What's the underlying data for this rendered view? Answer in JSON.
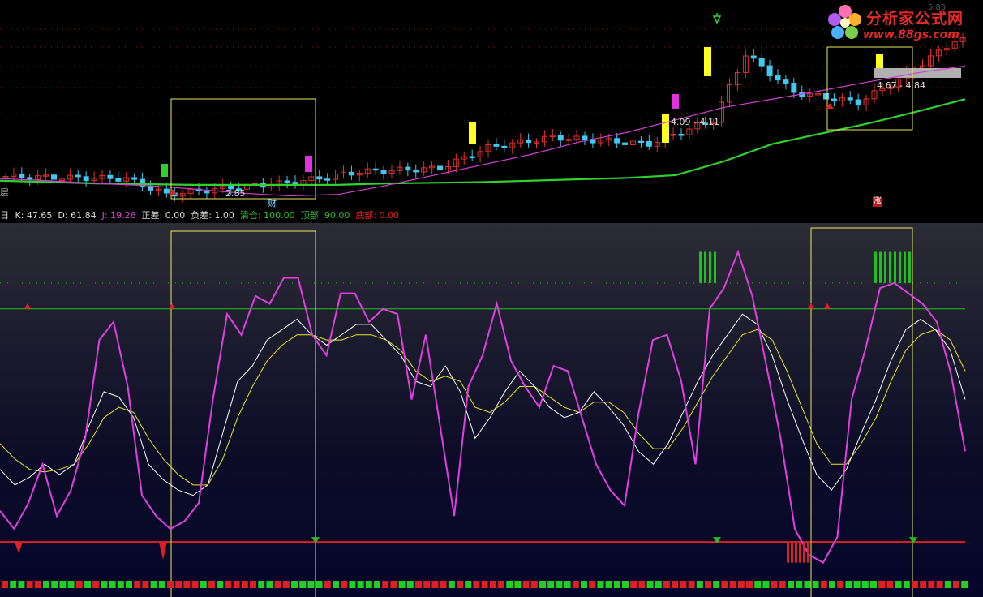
{
  "logo": {
    "name": "分析家公式网",
    "url": "www.88gs.com",
    "faint_value": "5.85"
  },
  "upper_panel": {
    "left_edge_label": "层",
    "annotations": {
      "low_price": "2.85",
      "signal_cai": "财",
      "range_1": "4.09 - 4.11",
      "range_2": "4.67 - 4.84",
      "signal_zhang": "涨"
    }
  },
  "indicator_legend": {
    "prefix": "日",
    "items": [
      {
        "label": "K:",
        "value": "47.65",
        "color": "#d8d8d8"
      },
      {
        "label": "D:",
        "value": "61.84",
        "color": "#d8d8d8"
      },
      {
        "label": "J:",
        "value": "19.26",
        "color": "#e040e0"
      },
      {
        "label": "正差:",
        "value": "0.00",
        "color": "#d8d8d8"
      },
      {
        "label": "负差:",
        "value": "1.00",
        "color": "#d8d8d8"
      },
      {
        "label": "清仓:",
        "value": "100.00",
        "color": "#30c030"
      },
      {
        "label": "顶部:",
        "value": "90.00",
        "color": "#30c030"
      },
      {
        "label": "底部:",
        "value": "0.00",
        "color": "#e02020"
      }
    ]
  },
  "colors": {
    "up_candle": "#e03030",
    "down_candle": "#40c8f0",
    "signal_yellow": "#ffff20",
    "signal_magenta": "#e030e0",
    "ma_green": "#30d030",
    "ma_magenta": "#d040d0",
    "kdj_k": "#ffffff",
    "kdj_d": "#e8e820",
    "kdj_j": "#e040e0",
    "top_line": "#20c020",
    "bottom_line": "#e02020",
    "box": "#e8e860"
  },
  "chart_data": [
    {
      "type": "line",
      "panel": "price (candlestick)",
      "description_series": [
        {
          "name": "",
          "role": "short MA (magenta)",
          "values": [
            2.95,
            2.92,
            2.88,
            2.85,
            2.8,
            2.74,
            2.7,
            2.72,
            2.85,
            3.0,
            3.15,
            3.3,
            3.48,
            3.62,
            3.8,
            3.98,
            4.1,
            4.22,
            4.35,
            4.48,
            4.58
          ]
        },
        {
          "name": "",
          "role": "long MA (green)",
          "values": [
            2.92,
            2.9,
            2.88,
            2.87,
            2.86,
            2.86,
            2.86,
            2.86,
            2.88,
            2.89,
            2.9,
            2.92,
            2.94,
            2.96,
            3.0,
            3.2,
            3.45,
            3.6,
            3.75,
            3.92,
            4.1
          ]
        }
      ],
      "annotations": [
        "2.85",
        "4.09 - 4.11",
        "4.67 - 4.84"
      ]
    },
    {
      "type": "line",
      "panel": "KDJ indicator",
      "ylim": [
        -10,
        120
      ],
      "reference_lines": {
        "top": 90,
        "clear": 100,
        "bottom": 0
      },
      "series": [
        {
          "name": "J",
          "values": [
            12,
            5,
            15,
            30,
            10,
            20,
            40,
            78,
            85,
            60,
            18,
            10,
            5,
            8,
            15,
            55,
            88,
            80,
            95,
            92,
            102,
            102,
            80,
            72,
            96,
            96,
            85,
            90,
            88,
            55,
            80,
            45,
            10,
            60,
            72,
            92,
            70,
            60,
            52,
            68,
            66,
            48,
            30,
            20,
            14,
            50,
            78,
            80,
            62,
            30,
            90,
            98,
            112,
            95,
            68,
            40,
            5,
            -5,
            -8,
            2,
            55,
            75,
            98,
            100,
            96,
            92,
            85,
            65,
            35
          ]
        },
        {
          "name": "K",
          "values": [
            28,
            22,
            25,
            30,
            26,
            30,
            45,
            58,
            56,
            48,
            30,
            24,
            20,
            18,
            22,
            42,
            62,
            68,
            78,
            82,
            86,
            80,
            76,
            80,
            84,
            84,
            78,
            72,
            62,
            60,
            68,
            58,
            40,
            48,
            58,
            66,
            60,
            52,
            48,
            50,
            58,
            52,
            45,
            35,
            30,
            38,
            50,
            62,
            72,
            80,
            88,
            84,
            72,
            55,
            40,
            26,
            20,
            28,
            42,
            55,
            70,
            82,
            86,
            82,
            74,
            55
          ]
        },
        {
          "name": "D",
          "values": [
            38,
            32,
            28,
            27,
            28,
            30,
            38,
            48,
            52,
            50,
            40,
            32,
            26,
            22,
            22,
            32,
            48,
            60,
            70,
            76,
            80,
            80,
            78,
            78,
            80,
            80,
            78,
            74,
            66,
            62,
            64,
            62,
            52,
            50,
            54,
            60,
            60,
            56,
            52,
            50,
            54,
            54,
            50,
            42,
            36,
            36,
            44,
            54,
            64,
            72,
            80,
            82,
            78,
            66,
            52,
            38,
            30,
            30,
            38,
            48,
            62,
            74,
            80,
            82,
            78,
            66
          ]
        }
      ]
    }
  ]
}
